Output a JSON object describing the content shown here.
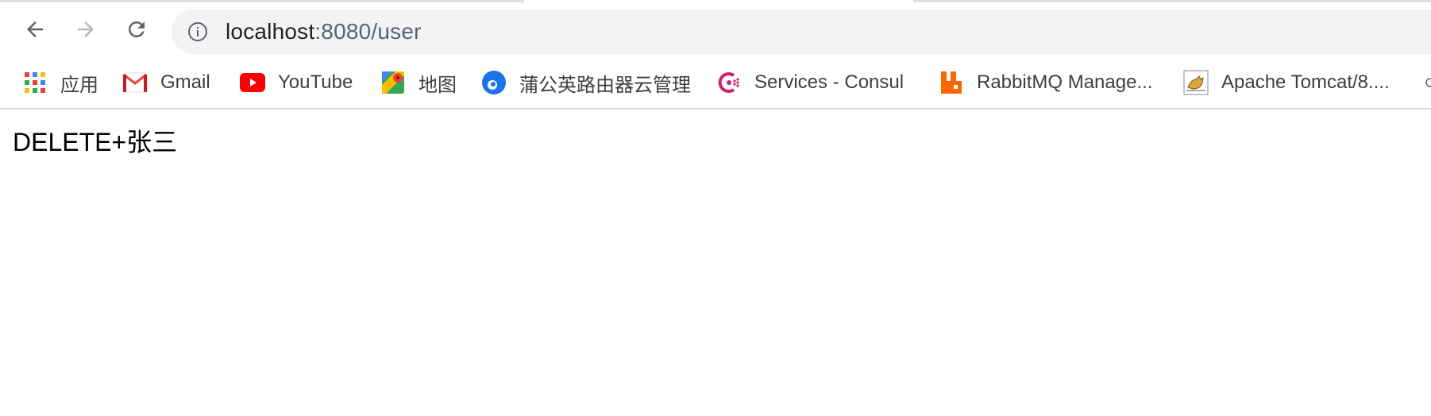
{
  "browser": {
    "url": {
      "host": "localhost",
      "rest": ":8080/user"
    }
  },
  "bookmarks": [
    {
      "label": "应用",
      "icon": "apps-grid-icon"
    },
    {
      "label": "Gmail",
      "icon": "gmail-icon"
    },
    {
      "label": "YouTube",
      "icon": "youtube-icon"
    },
    {
      "label": "地图",
      "icon": "maps-icon"
    },
    {
      "label": "蒲公英路由器云管理",
      "icon": "pgy-icon"
    },
    {
      "label": "Services - Consul",
      "icon": "consul-icon"
    },
    {
      "label": "RabbitMQ Manage...",
      "icon": "rabbitmq-icon"
    },
    {
      "label": "Apache Tomcat/8....",
      "icon": "tomcat-icon"
    }
  ],
  "page": {
    "body_text": "DELETE+张三"
  },
  "colors": {
    "omnibox_bg": "#f1f3f4",
    "youtube_red": "#ff0000",
    "rabbitmq_orange": "#ff6600",
    "consul_pink": "#ca2171",
    "pgy_blue": "#1a73e8"
  }
}
